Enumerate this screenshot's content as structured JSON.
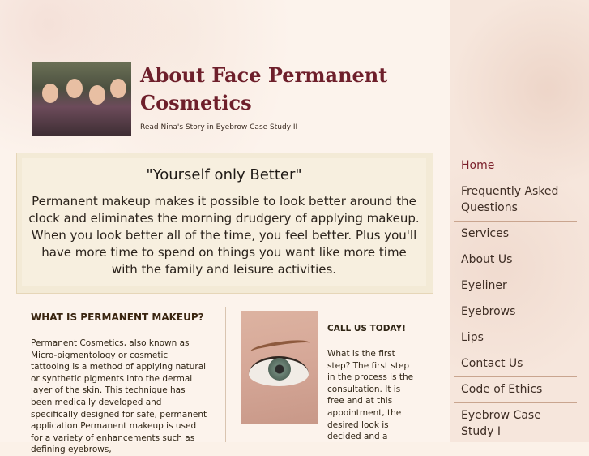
{
  "header": {
    "title": "About Face Permanent Cosmetics",
    "tagline": "Read Nina's Story in Eyebrow Case Study II"
  },
  "banner": {
    "heading": "\"Yourself only Better\"",
    "text": "Permanent makeup makes it possible to look better around the clock and eliminates the morning drudgery of applying makeup. When you look better all of the time, you feel better. Plus you'll have more time to spend on things you want like more time with the family and leisure activities."
  },
  "main": {
    "section_title": "WHAT IS PERMANENT MAKEUP?",
    "section_text": "Permanent Cosmetics, also known as Micro-pigmentology or cosmetic tattooing is a method of applying natural or synthetic pigments into the dermal layer of the skin. This technique has been medically developed and specifically designed for safe, permanent application.Permanent makeup is used for a variety of enhancements such as defining eyebrows,",
    "call_title": "CALL US TODAY!",
    "call_text": "What is the first step? The first step in the process is the consultation. It is free and at this appointment, the desired look is decided and a"
  },
  "nav": {
    "items": [
      {
        "label": "Home",
        "active": true
      },
      {
        "label": "Frequently Asked Questions"
      },
      {
        "label": "Services"
      },
      {
        "label": "About Us"
      },
      {
        "label": "Eyeliner"
      },
      {
        "label": "Eyebrows"
      },
      {
        "label": "Lips"
      },
      {
        "label": "Contact Us"
      },
      {
        "label": "Code of Ethics"
      },
      {
        "label": "Eyebrow Case Study I"
      }
    ]
  },
  "colors": {
    "title": "#6e1f2b",
    "active_nav": "#7a1f2a",
    "nav_border": "#c9a58f"
  }
}
